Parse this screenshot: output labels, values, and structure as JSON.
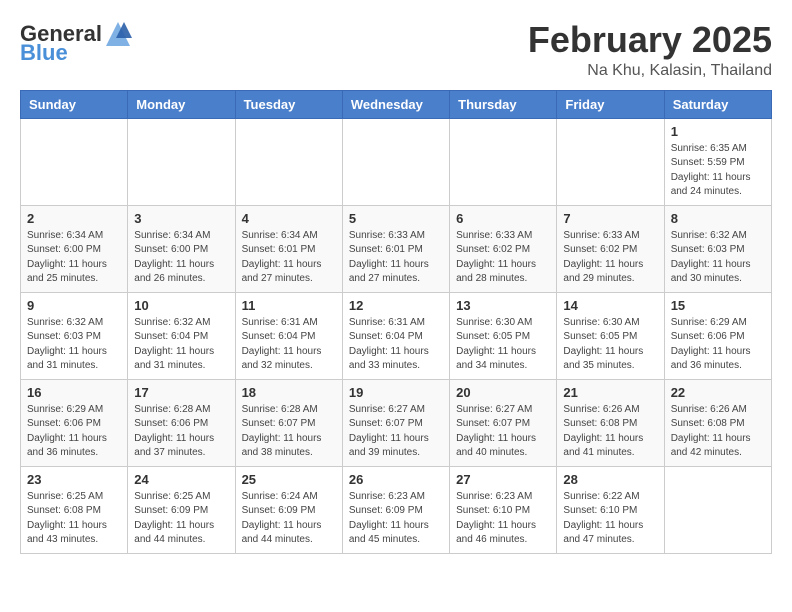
{
  "header": {
    "logo_general": "General",
    "logo_blue": "Blue",
    "month_title": "February 2025",
    "location": "Na Khu, Kalasin, Thailand"
  },
  "weekdays": [
    "Sunday",
    "Monday",
    "Tuesday",
    "Wednesday",
    "Thursday",
    "Friday",
    "Saturday"
  ],
  "weeks": [
    [
      {
        "day": "",
        "info": ""
      },
      {
        "day": "",
        "info": ""
      },
      {
        "day": "",
        "info": ""
      },
      {
        "day": "",
        "info": ""
      },
      {
        "day": "",
        "info": ""
      },
      {
        "day": "",
        "info": ""
      },
      {
        "day": "1",
        "info": "Sunrise: 6:35 AM\nSunset: 5:59 PM\nDaylight: 11 hours\nand 24 minutes."
      }
    ],
    [
      {
        "day": "2",
        "info": "Sunrise: 6:34 AM\nSunset: 6:00 PM\nDaylight: 11 hours\nand 25 minutes."
      },
      {
        "day": "3",
        "info": "Sunrise: 6:34 AM\nSunset: 6:00 PM\nDaylight: 11 hours\nand 26 minutes."
      },
      {
        "day": "4",
        "info": "Sunrise: 6:34 AM\nSunset: 6:01 PM\nDaylight: 11 hours\nand 27 minutes."
      },
      {
        "day": "5",
        "info": "Sunrise: 6:33 AM\nSunset: 6:01 PM\nDaylight: 11 hours\nand 27 minutes."
      },
      {
        "day": "6",
        "info": "Sunrise: 6:33 AM\nSunset: 6:02 PM\nDaylight: 11 hours\nand 28 minutes."
      },
      {
        "day": "7",
        "info": "Sunrise: 6:33 AM\nSunset: 6:02 PM\nDaylight: 11 hours\nand 29 minutes."
      },
      {
        "day": "8",
        "info": "Sunrise: 6:32 AM\nSunset: 6:03 PM\nDaylight: 11 hours\nand 30 minutes."
      }
    ],
    [
      {
        "day": "9",
        "info": "Sunrise: 6:32 AM\nSunset: 6:03 PM\nDaylight: 11 hours\nand 31 minutes."
      },
      {
        "day": "10",
        "info": "Sunrise: 6:32 AM\nSunset: 6:04 PM\nDaylight: 11 hours\nand 31 minutes."
      },
      {
        "day": "11",
        "info": "Sunrise: 6:31 AM\nSunset: 6:04 PM\nDaylight: 11 hours\nand 32 minutes."
      },
      {
        "day": "12",
        "info": "Sunrise: 6:31 AM\nSunset: 6:04 PM\nDaylight: 11 hours\nand 33 minutes."
      },
      {
        "day": "13",
        "info": "Sunrise: 6:30 AM\nSunset: 6:05 PM\nDaylight: 11 hours\nand 34 minutes."
      },
      {
        "day": "14",
        "info": "Sunrise: 6:30 AM\nSunset: 6:05 PM\nDaylight: 11 hours\nand 35 minutes."
      },
      {
        "day": "15",
        "info": "Sunrise: 6:29 AM\nSunset: 6:06 PM\nDaylight: 11 hours\nand 36 minutes."
      }
    ],
    [
      {
        "day": "16",
        "info": "Sunrise: 6:29 AM\nSunset: 6:06 PM\nDaylight: 11 hours\nand 36 minutes."
      },
      {
        "day": "17",
        "info": "Sunrise: 6:28 AM\nSunset: 6:06 PM\nDaylight: 11 hours\nand 37 minutes."
      },
      {
        "day": "18",
        "info": "Sunrise: 6:28 AM\nSunset: 6:07 PM\nDaylight: 11 hours\nand 38 minutes."
      },
      {
        "day": "19",
        "info": "Sunrise: 6:27 AM\nSunset: 6:07 PM\nDaylight: 11 hours\nand 39 minutes."
      },
      {
        "day": "20",
        "info": "Sunrise: 6:27 AM\nSunset: 6:07 PM\nDaylight: 11 hours\nand 40 minutes."
      },
      {
        "day": "21",
        "info": "Sunrise: 6:26 AM\nSunset: 6:08 PM\nDaylight: 11 hours\nand 41 minutes."
      },
      {
        "day": "22",
        "info": "Sunrise: 6:26 AM\nSunset: 6:08 PM\nDaylight: 11 hours\nand 42 minutes."
      }
    ],
    [
      {
        "day": "23",
        "info": "Sunrise: 6:25 AM\nSunset: 6:08 PM\nDaylight: 11 hours\nand 43 minutes."
      },
      {
        "day": "24",
        "info": "Sunrise: 6:25 AM\nSunset: 6:09 PM\nDaylight: 11 hours\nand 44 minutes."
      },
      {
        "day": "25",
        "info": "Sunrise: 6:24 AM\nSunset: 6:09 PM\nDaylight: 11 hours\nand 44 minutes."
      },
      {
        "day": "26",
        "info": "Sunrise: 6:23 AM\nSunset: 6:09 PM\nDaylight: 11 hours\nand 45 minutes."
      },
      {
        "day": "27",
        "info": "Sunrise: 6:23 AM\nSunset: 6:10 PM\nDaylight: 11 hours\nand 46 minutes."
      },
      {
        "day": "28",
        "info": "Sunrise: 6:22 AM\nSunset: 6:10 PM\nDaylight: 11 hours\nand 47 minutes."
      },
      {
        "day": "",
        "info": ""
      }
    ]
  ]
}
